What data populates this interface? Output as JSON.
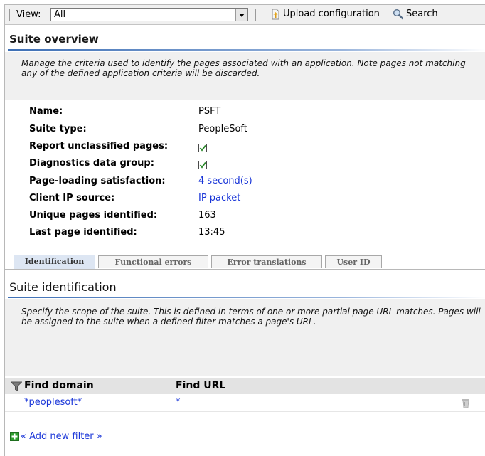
{
  "toolbar": {
    "view_label": "View:",
    "view_value": "All",
    "upload_label": "Upload configuration",
    "search_label": "Search"
  },
  "overview": {
    "title": "Suite overview",
    "description": "Manage the criteria used to identify the pages associated with an application. Note pages not matching any of the defined application criteria will be discarded.",
    "fields": [
      {
        "label": "Name:",
        "value": "PSFT"
      },
      {
        "label": "Suite type:",
        "value": "PeopleSoft"
      },
      {
        "label": "Report unclassified pages:",
        "checked": true
      },
      {
        "label": "Diagnostics data group:",
        "checked": true
      },
      {
        "label": "Page-loading satisfaction:",
        "value": "4 second(s)"
      },
      {
        "label": "Client IP source:",
        "value": "IP packet"
      },
      {
        "label": "Unique pages identified:",
        "value": "163"
      },
      {
        "label": "Last page identified:",
        "value": "13:45"
      }
    ]
  },
  "tabs": [
    {
      "label": "Identification",
      "active": true
    },
    {
      "label": "Functional errors"
    },
    {
      "label": "Error translations"
    },
    {
      "label": "User ID"
    }
  ],
  "identification": {
    "title": "Suite identification",
    "description": "Specify the scope of the suite. This is defined in terms of one or more partial page URL matches. Pages will be assigned to the suite when a defined filter matches a page's URL.",
    "columns": [
      "Find domain",
      "Find URL"
    ],
    "rows": [
      {
        "domain": "*peoplesoft*",
        "url": "*"
      }
    ],
    "add_filter": "« Add new filter »"
  },
  "colors": {
    "link": "#1a36d8",
    "rule": "#3d6fb5",
    "band": "#f0f0f0",
    "check": "#2e8b2e",
    "add": "#2e9e2e"
  },
  "icons": [
    "upload-icon",
    "search-icon",
    "checkbox-icon",
    "filter-icon",
    "delete-icon",
    "add-icon"
  ]
}
